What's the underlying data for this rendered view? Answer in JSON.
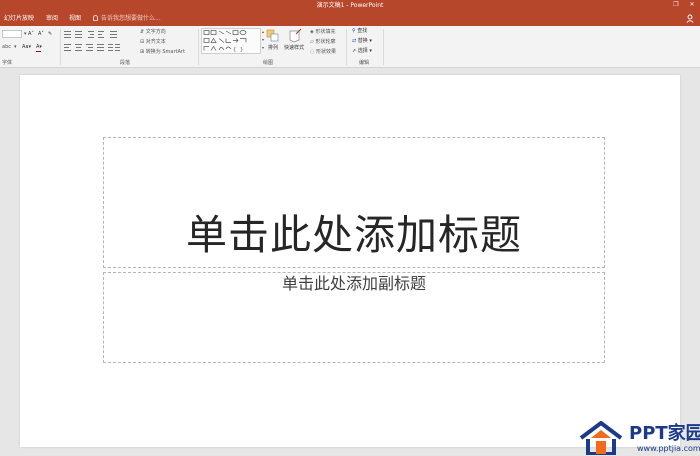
{
  "titlebar": {
    "title": "演示文稿1 - PowerPoint",
    "restore_glyph": "❐",
    "close_glyph": "✕"
  },
  "menu": {
    "tabs": [
      "幻灯片放映",
      "审阅",
      "视图"
    ],
    "tell_me": "告诉我您想要做什么..."
  },
  "ribbon": {
    "groups": {
      "font": "字体",
      "paragraph": "段落",
      "drawing": "绘图",
      "editing": "编辑"
    },
    "paragraph": {
      "text_direction": "文字方向",
      "align_text": "对齐文本",
      "convert_smartart": "转换为 SmartArt"
    },
    "drawing": {
      "arrange": "排列",
      "quick_styles": "快速样式",
      "shape_fill": "形状填充",
      "shape_outline": "形状轮廓",
      "shape_effects": "形状效果"
    },
    "editing": {
      "find": "查找",
      "replace": "替换",
      "select": "选择"
    }
  },
  "slide": {
    "title_placeholder": "单击此处添加标题",
    "subtitle_placeholder": "单击此处添加副标题"
  },
  "watermark": {
    "brand": "PPT家园",
    "url": "www.pptjia.com"
  },
  "colors": {
    "accent": "#b7472a",
    "ribbon_bg": "#f3f3f3",
    "workspace_bg": "#e6e6e6",
    "watermark_blue": "#1b3a8a",
    "watermark_orange": "#f26b1d"
  }
}
